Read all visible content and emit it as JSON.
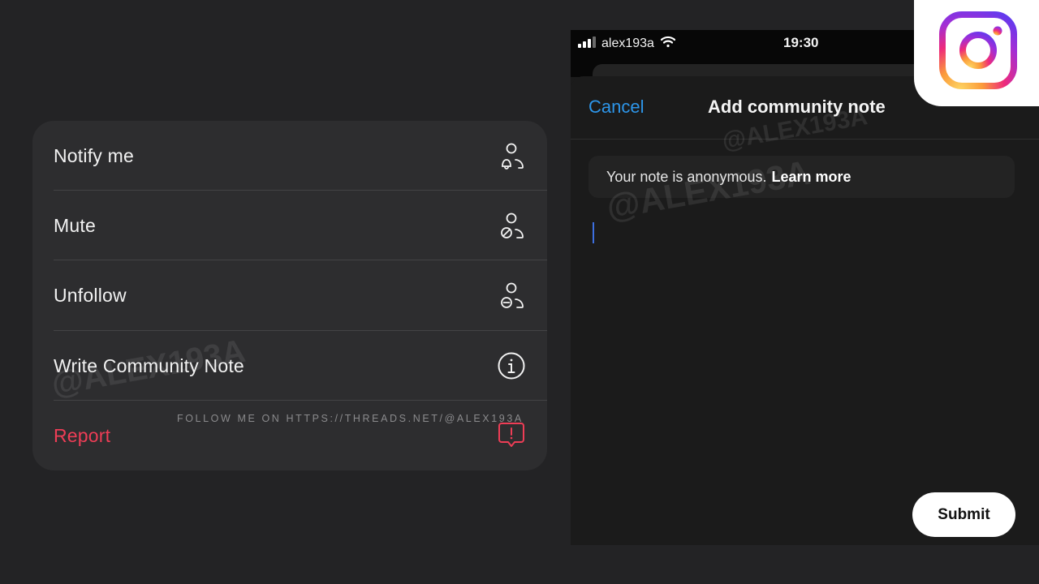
{
  "menu": {
    "items": [
      {
        "label": "Notify me",
        "icon": "person-bell-icon"
      },
      {
        "label": "Mute",
        "icon": "person-mute-icon"
      },
      {
        "label": "Unfollow",
        "icon": "person-minus-icon"
      },
      {
        "label": "Write Community Note",
        "icon": "info-circle-icon"
      },
      {
        "label": "Report",
        "icon": "report-alert-icon",
        "color": "#ee3d56"
      }
    ]
  },
  "watermark": {
    "handle": "@ALEX193A",
    "follow_text": "FOLLOW ME ON HTTPS://THREADS.NET/@ALEX193A"
  },
  "phone": {
    "status_bar": {
      "carrier": "alex193a",
      "time": "19:30",
      "icons": [
        "signal-icon",
        "wifi-icon"
      ]
    },
    "sheet": {
      "cancel_label": "Cancel",
      "title": "Add community note",
      "notice_text": "Your note is anonymous.",
      "learn_more": "Learn more",
      "submit_label": "Submit",
      "accent": "#2d96ea"
    }
  },
  "brand": {
    "logo": "instagram-logo-icon"
  }
}
